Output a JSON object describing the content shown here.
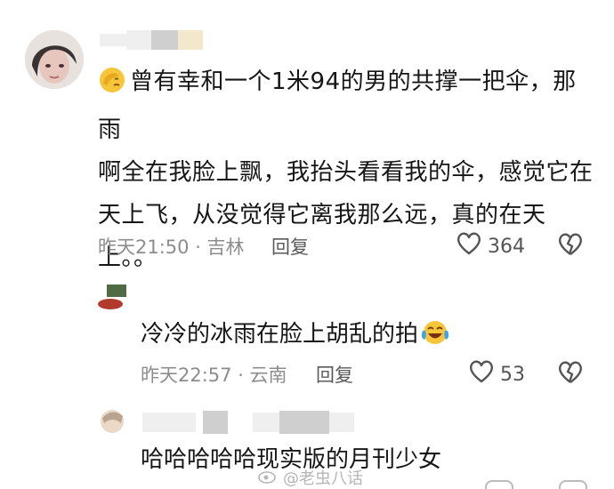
{
  "comment_main": {
    "username": "",
    "text_line1": "曾有幸和一个1米94的男的共撑一把伞，那雨",
    "text_line2": "啊全在我脸上飘，我抬头看看我的伞，感觉它在",
    "text_line3": "天上飞，从没觉得它离我那么远，真的在天",
    "text_line4": "上。。",
    "time_location": "昨天21:50 · 吉林",
    "reply_label": "回复",
    "like_count": "364",
    "emoji": "face-palm-emoji"
  },
  "reply_1": {
    "text": "冷冷的冰雨在脸上胡乱的拍",
    "time_location": "昨天22:57 · 云南",
    "reply_label": "回复",
    "like_count": "53",
    "emoji": "laugh-cry-emoji"
  },
  "reply_2": {
    "text": "哈哈哈哈哈现实版的月刊少女"
  },
  "watermark": {
    "text": "@老虫八话"
  },
  "icons": {
    "like": "heart-outline-icon",
    "dislike": "broken-heart-icon"
  },
  "colors": {
    "text_primary": "#161616",
    "text_meta": "#8d8d8d",
    "background": "#ffffff"
  }
}
